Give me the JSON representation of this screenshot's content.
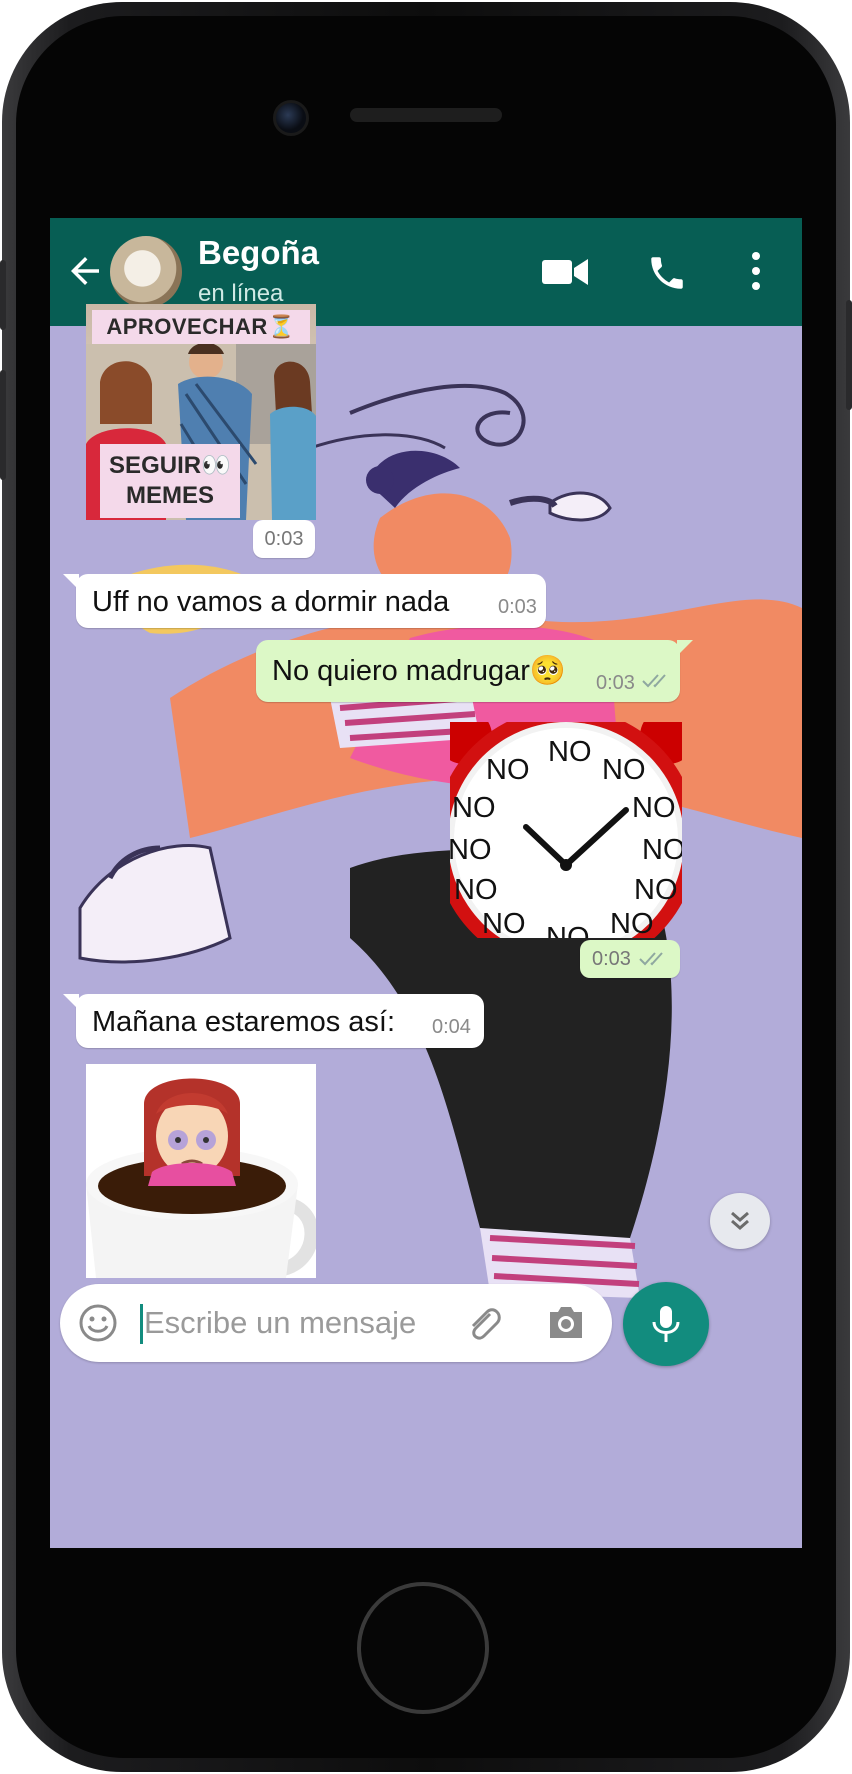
{
  "header": {
    "contact_name": "Begoña",
    "status": "en línea",
    "color": "#075e54"
  },
  "icons": {
    "back": "arrow-left",
    "video": "video-camera",
    "call": "phone",
    "more": "three-dots-vertical",
    "emoji": "smiley",
    "attach": "paperclip",
    "camera": "camera",
    "mic": "microphone",
    "scroll": "double-chevron-down"
  },
  "messages": [
    {
      "type": "sticker",
      "direction": "in",
      "sticker": "distracted-boyfriend-meme",
      "top_text": "APROVECHAR⏳",
      "bottom_line1": "SEGUIR👀",
      "bottom_line2": "MEMES",
      "time": "0:03"
    },
    {
      "type": "text",
      "direction": "in",
      "text": "Uff no vamos a dormir nada",
      "time": "0:03"
    },
    {
      "type": "text",
      "direction": "out",
      "text": "No quiero madrugar🥺",
      "time": "0:03",
      "read": true
    },
    {
      "type": "sticker",
      "direction": "out",
      "sticker": "no-clock",
      "clock_word": "NO",
      "time": "0:03",
      "read": true
    },
    {
      "type": "text",
      "direction": "in",
      "text": "Mañana estaremos así:",
      "time": "0:04"
    },
    {
      "type": "sticker",
      "direction": "in",
      "sticker": "girl-in-coffee-cup"
    }
  ],
  "composer": {
    "placeholder": "Escribe un mensaje"
  },
  "colors": {
    "wallpaper": "#b2acd9",
    "incoming": "#ffffff",
    "outgoing": "#dcf8c6",
    "accent": "#128c7e",
    "read_ticks": "#4fc3f7"
  }
}
